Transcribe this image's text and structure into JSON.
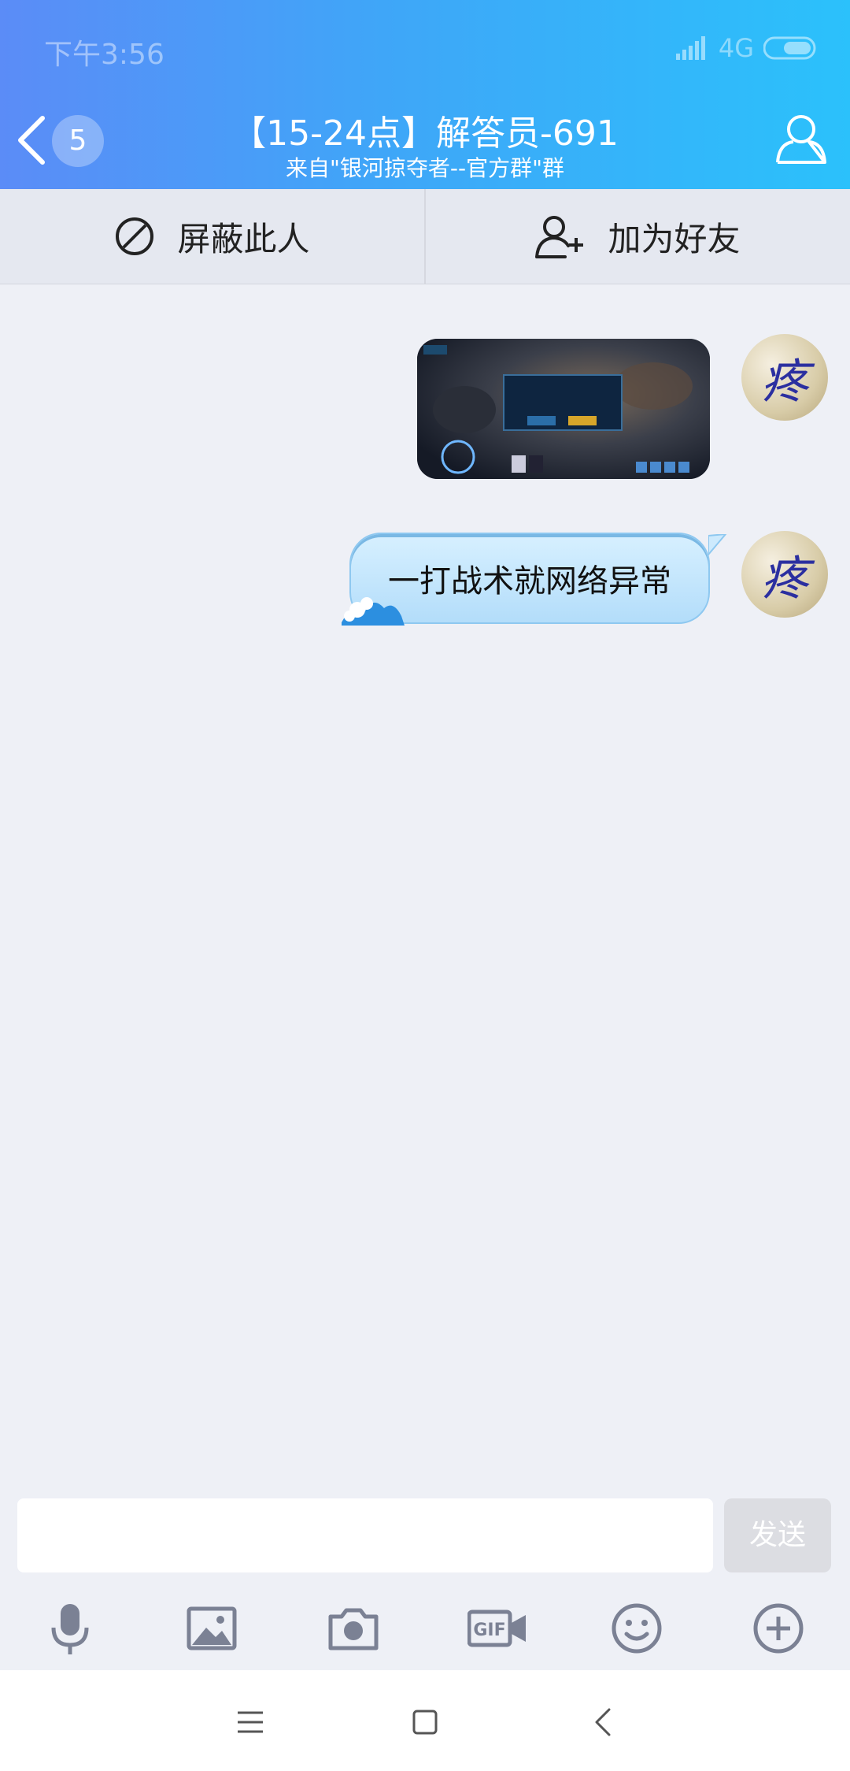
{
  "status_bar": {
    "time": "下午3:56",
    "network": "4G"
  },
  "header": {
    "unread_badge": "5",
    "title": "【15-24点】解答员-691",
    "subtitle": "来自\"银河掠夺者--官方群\"群"
  },
  "actions": {
    "block_label": "屏蔽此人",
    "add_friend_label": "加为好友"
  },
  "messages": {
    "text_message": "一打战术就网络异常",
    "avatar_char": "疼"
  },
  "input": {
    "placeholder": "",
    "send_label": "发送"
  },
  "colors": {
    "header_start": "#5b8cf7",
    "header_end": "#2bc1fb",
    "bubble": "#c6e7fc",
    "background": "#eef0f6"
  }
}
